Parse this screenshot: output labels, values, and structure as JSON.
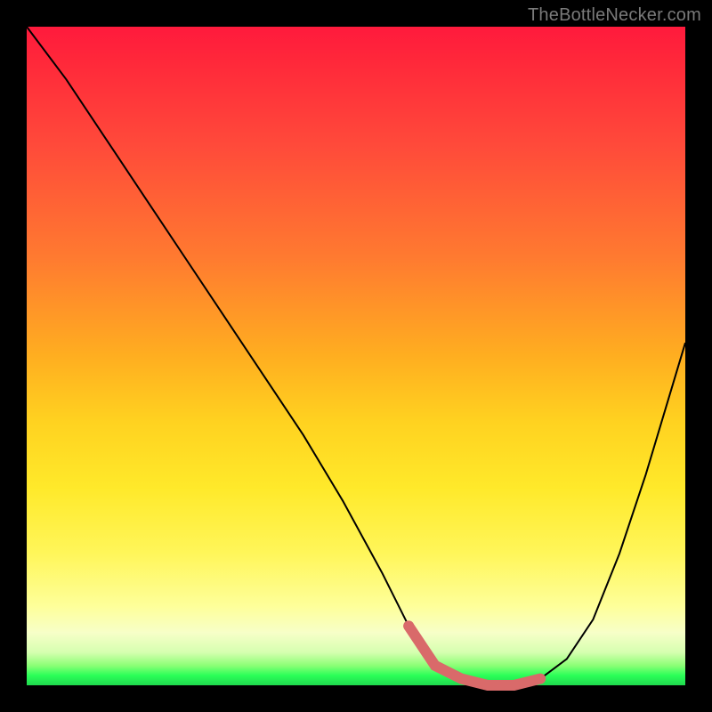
{
  "watermark": "TheBottleNecker.com",
  "chart_data": {
    "type": "line",
    "title": "",
    "xlabel": "",
    "ylabel": "",
    "xlim": [
      0,
      100
    ],
    "ylim": [
      0,
      100
    ],
    "series": [
      {
        "name": "bottleneck-curve",
        "x": [
          0,
          6,
          12,
          18,
          24,
          30,
          36,
          42,
          48,
          54,
          58,
          62,
          66,
          70,
          74,
          78,
          82,
          86,
          90,
          94,
          100
        ],
        "values": [
          100,
          92,
          83,
          74,
          65,
          56,
          47,
          38,
          28,
          17,
          9,
          3,
          1,
          0,
          0,
          1,
          4,
          10,
          20,
          32,
          52
        ]
      }
    ],
    "markers": {
      "name": "highlight-points",
      "x": [
        58,
        62,
        66,
        70,
        74,
        78
      ],
      "values": [
        9,
        3,
        1,
        0,
        0,
        1
      ]
    },
    "background_gradient": {
      "top": "#ff1a3c",
      "mid": "#ffe92a",
      "bottom": "#1fd94e"
    }
  }
}
